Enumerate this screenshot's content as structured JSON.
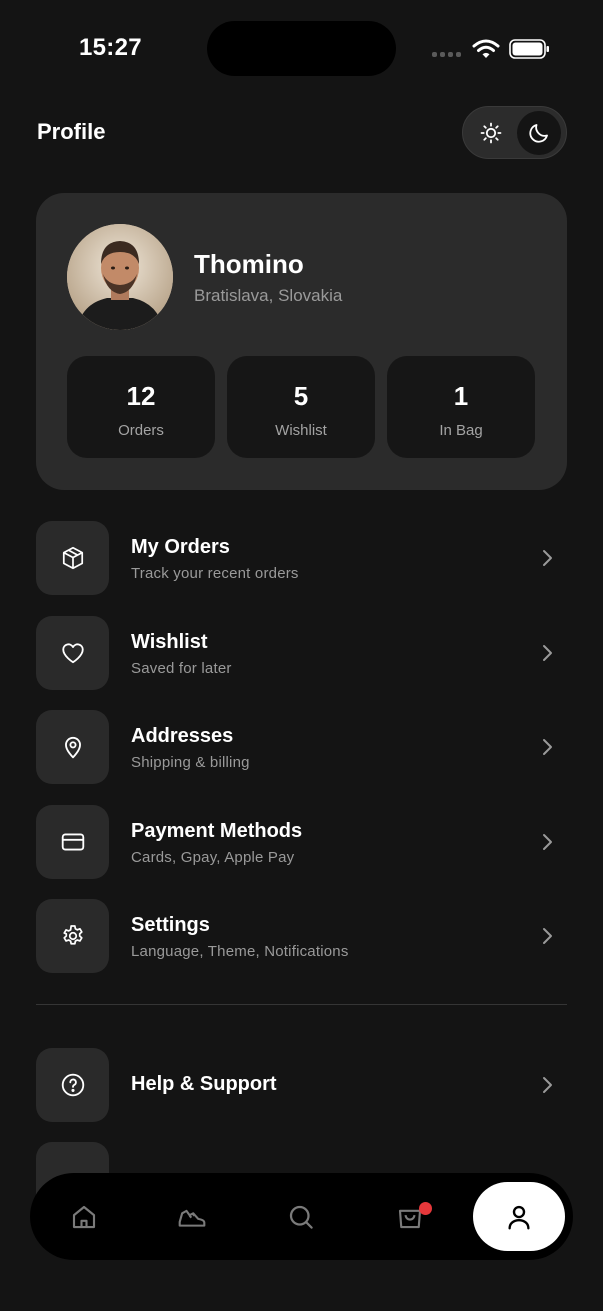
{
  "status_bar": {
    "time": "15:27"
  },
  "header": {
    "title": "Profile"
  },
  "theme_toggle": {
    "options": [
      "sun-icon",
      "moon-icon"
    ],
    "selected": "dark"
  },
  "profile": {
    "name": "Thomino",
    "location": "Bratislava, Slovakia",
    "stats": [
      {
        "value": "12",
        "label": "Orders"
      },
      {
        "value": "5",
        "label": "Wishlist"
      },
      {
        "value": "1",
        "label": "In Bag"
      }
    ]
  },
  "menu": {
    "items": [
      {
        "title": "My Orders",
        "subtitle": "Track your recent orders",
        "icon": "box-icon"
      },
      {
        "title": "Wishlist",
        "subtitle": "Saved for later",
        "icon": "heart-icon"
      },
      {
        "title": "Addresses",
        "subtitle": "Shipping & billing",
        "icon": "location-pin-icon"
      },
      {
        "title": "Payment Methods",
        "subtitle": "Cards, Gpay, Apple Pay",
        "icon": "credit-card-icon"
      },
      {
        "title": "Settings",
        "subtitle": "Language, Theme, Notifications",
        "icon": "gear-icon"
      }
    ],
    "secondary": [
      {
        "title": "Help & Support",
        "icon": "help-circle-icon"
      }
    ]
  },
  "bottom_nav": {
    "items": [
      "home-icon",
      "sneaker-icon",
      "search-icon",
      "bag-icon",
      "user-icon"
    ],
    "active": "user-icon",
    "bag_badge": true
  },
  "colors": {
    "background": "#141414",
    "card": "#2b2b2b",
    "badge": "#e5383b"
  }
}
